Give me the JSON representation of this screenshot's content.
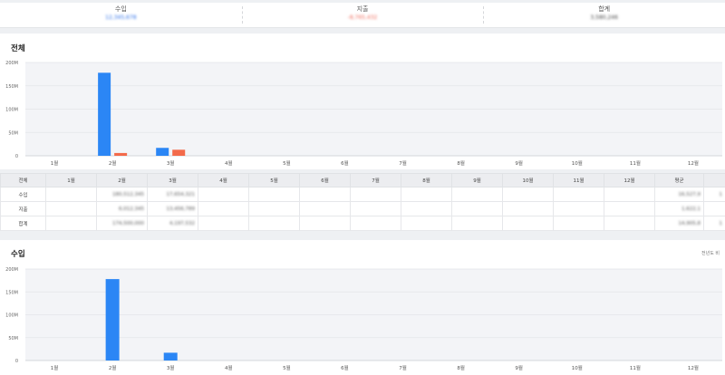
{
  "summary": {
    "income": {
      "label": "수입",
      "value": "12,345,678"
    },
    "expense": {
      "label": "지출",
      "value": "-8,765,432"
    },
    "total": {
      "label": "합계",
      "value": "3,580,246"
    }
  },
  "colors": {
    "income": "#2b86f5",
    "expense": "#f36a4a",
    "grid": "#e3e5e8",
    "plot_bg": "#f3f4f7"
  },
  "overall_panel": {
    "title": "전체"
  },
  "income_panel": {
    "title": "수입",
    "note": "전년도 비"
  },
  "table": {
    "headers": [
      "전체",
      "1월",
      "2월",
      "3월",
      "4월",
      "5월",
      "6월",
      "7월",
      "8월",
      "9월",
      "10월",
      "11월",
      "12월",
      "평균",
      ""
    ],
    "rows": [
      {
        "label": "수입",
        "cells": [
          "",
          "180,512,345",
          "17,654,321",
          "",
          "",
          "",
          "",
          "",
          "",
          "",
          "",
          "",
          "16,527,9",
          "1"
        ]
      },
      {
        "label": "지출",
        "cells": [
          "",
          "6,012,345",
          "13,456,789",
          "",
          "",
          "",
          "",
          "",
          "",
          "",
          "",
          "",
          "1,622,1",
          ""
        ]
      },
      {
        "label": "합계",
        "cells": [
          "",
          "174,500,000",
          "4,197,532",
          "",
          "",
          "",
          "",
          "",
          "",
          "",
          "",
          "",
          "14,905,8",
          "1"
        ]
      }
    ]
  },
  "chart_data": [
    {
      "type": "bar",
      "categories": [
        "1월",
        "2월",
        "3월",
        "4월",
        "5월",
        "6월",
        "7월",
        "8월",
        "9월",
        "10월",
        "11월",
        "12월"
      ],
      "series": [
        {
          "key": "income",
          "values": [
            0,
            178,
            17,
            0,
            0,
            0,
            0,
            0,
            0,
            0,
            0,
            0
          ]
        },
        {
          "key": "expense",
          "values": [
            0,
            6,
            13,
            0,
            0,
            0,
            0,
            0,
            0,
            0,
            0,
            0
          ]
        }
      ],
      "yticks": [
        "0",
        "50M",
        "100M",
        "150M",
        "200M"
      ],
      "ylim": [
        0,
        200
      ],
      "grid": true
    },
    {
      "type": "bar",
      "categories": [
        "1월",
        "2월",
        "3월",
        "4월",
        "5월",
        "6월",
        "7월",
        "8월",
        "9월",
        "10월",
        "11월",
        "12월"
      ],
      "series": [
        {
          "key": "income",
          "values": [
            0,
            178,
            17,
            0,
            0,
            0,
            0,
            0,
            0,
            0,
            0,
            0
          ]
        }
      ],
      "yticks": [
        "0",
        "50M",
        "100M",
        "150M",
        "200M"
      ],
      "ylim": [
        0,
        200
      ],
      "grid": true
    }
  ]
}
